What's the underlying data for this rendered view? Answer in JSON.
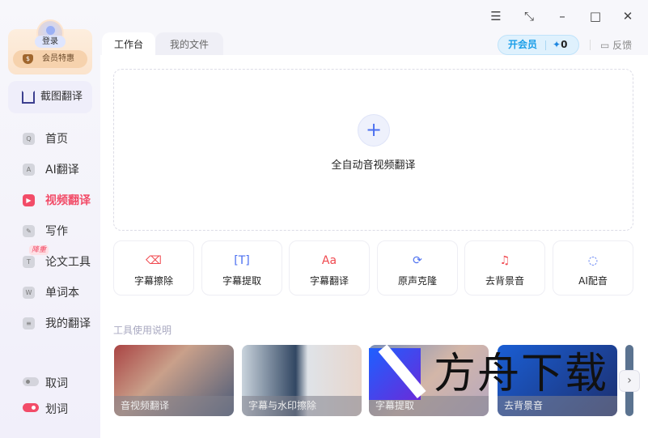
{
  "window": {
    "controls": [
      "menu-icon",
      "restore-icon",
      "minimize-icon",
      "maximize-icon",
      "close-icon"
    ]
  },
  "user": {
    "login": "登录",
    "vip_offer": "会员特惠"
  },
  "crop_translate": "截图翻译",
  "nav": [
    {
      "label": "首页",
      "icon": "home-icon"
    },
    {
      "label": "AI翻译",
      "icon": "ai-translate-icon"
    },
    {
      "label": "视频翻译",
      "icon": "video-icon",
      "active": true
    },
    {
      "label": "写作",
      "icon": "pen-icon"
    },
    {
      "label": "论文工具",
      "icon": "thesis-icon",
      "badge": "降重"
    },
    {
      "label": "单词本",
      "icon": "wordbook-icon"
    },
    {
      "label": "我的翻译",
      "icon": "my-translation-icon"
    }
  ],
  "toggles": [
    {
      "label": "取词",
      "on": false
    },
    {
      "label": "划词",
      "on": true
    }
  ],
  "tabs": [
    "工作台",
    "我的文件"
  ],
  "header": {
    "vip": "开会员",
    "points": "0",
    "feedback": "反馈"
  },
  "upload": {
    "label": "全自动音视频翻译"
  },
  "tools": [
    {
      "label": "字幕擦除",
      "icon": "eraser-icon",
      "color": "#f0494f"
    },
    {
      "label": "字幕提取",
      "icon": "text-extract-icon",
      "color": "#4b6ff0"
    },
    {
      "label": "字幕翻译",
      "icon": "subtitle-translate-icon",
      "color": "#f0494f"
    },
    {
      "label": "原声克隆",
      "icon": "voice-clone-icon",
      "color": "#4b6ff0"
    },
    {
      "label": "去背景音",
      "icon": "music-off-icon",
      "color": "#f0494f"
    },
    {
      "label": "AI配音",
      "icon": "ai-dubbing-icon",
      "color": "#4b6ff0"
    }
  ],
  "guide": {
    "title": "工具使用说明",
    "cards": [
      "音视频翻译",
      "字幕与水印擦除",
      "字幕提取",
      "去背景音"
    ]
  },
  "watermark": "方舟下载",
  "colors": {
    "accent": "#f24c68",
    "blue": "#4b6ff0"
  }
}
